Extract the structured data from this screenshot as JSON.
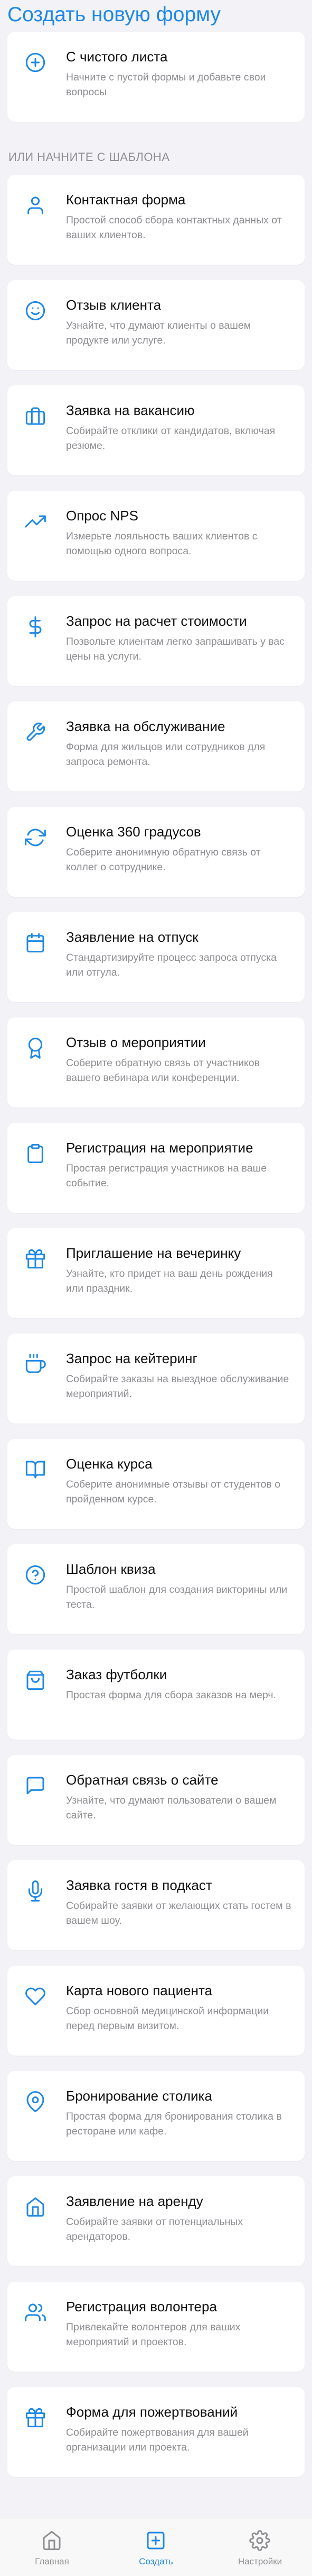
{
  "page": {
    "title": "Создать новую форму",
    "accent_color": "#1e88e5"
  },
  "blank": {
    "title": "С чистого листа",
    "description": "Начните с пустой формы и добавьте свои вопросы",
    "icon": "plus-circle-icon"
  },
  "templates_section": {
    "label": "ИЛИ НАЧНИТЕ С ШАБЛОНА",
    "items": [
      {
        "title": "Контактная форма",
        "description": "Простой способ сбора контактных данных от ваших клиентов.",
        "icon": "person-icon"
      },
      {
        "title": "Отзыв клиента",
        "description": "Узнайте, что думают клиенты о вашем продукте или услуге.",
        "icon": "smile-icon"
      },
      {
        "title": "Заявка на вакансию",
        "description": "Собирайте отклики от кандидатов, включая резюме.",
        "icon": "briefcase-icon"
      },
      {
        "title": "Опрос NPS",
        "description": "Измерьте лояльность ваших клиентов с помощью одного вопроса.",
        "icon": "trending-up-icon"
      },
      {
        "title": "Запрос на расчет стоимости",
        "description": "Позвольте клиентам легко запрашивать у вас цены на услуги.",
        "icon": "dollar-icon"
      },
      {
        "title": "Заявка на обслуживание",
        "description": "Форма для жильцов или сотрудников для запроса ремонта.",
        "icon": "wrench-icon"
      },
      {
        "title": "Оценка 360 градусов",
        "description": "Соберите анонимную обратную связь от коллег о сотруднике.",
        "icon": "refresh-icon"
      },
      {
        "title": "Заявление на отпуск",
        "description": "Стандартизируйте процесс запроса отпуска или отгула.",
        "icon": "calendar-icon"
      },
      {
        "title": "Отзыв о мероприятии",
        "description": "Соберите обратную связь от участников вашего вебинара или конференции.",
        "icon": "award-icon"
      },
      {
        "title": "Регистрация на мероприятие",
        "description": "Простая регистрация участников на ваше событие.",
        "icon": "clipboard-icon"
      },
      {
        "title": "Приглашение на вечеринку",
        "description": "Узнайте, кто придет на ваш день рождения или праздник.",
        "icon": "gift-icon"
      },
      {
        "title": "Запрос на кейтеринг",
        "description": "Собирайте заказы на выездное обслуживание мероприятий.",
        "icon": "coffee-icon"
      },
      {
        "title": "Оценка курса",
        "description": "Соберите анонимные отзывы от студентов о пройденном курсе.",
        "icon": "book-icon"
      },
      {
        "title": "Шаблон квиза",
        "description": "Простой шаблон для создания викторины или теста.",
        "icon": "help-circle-icon"
      },
      {
        "title": "Заказ футболки",
        "description": "Простая форма для сбора заказов на мерч.",
        "icon": "shopping-bag-icon"
      },
      {
        "title": "Обратная связь о сайте",
        "description": "Узнайте, что думают пользователи о вашем сайте.",
        "icon": "message-square-icon"
      },
      {
        "title": "Заявка гостя в подкаст",
        "description": "Собирайте заявки от желающих стать гостем в вашем шоу.",
        "icon": "mic-icon"
      },
      {
        "title": "Карта нового пациента",
        "description": "Сбор основной медицинской информации перед первым визитом.",
        "icon": "heart-icon"
      },
      {
        "title": "Бронирование столика",
        "description": "Простая форма для бронирования столика в ресторане или кафе.",
        "icon": "map-pin-icon"
      },
      {
        "title": "Заявление на аренду",
        "description": "Собирайте заявки от потенциальных арендаторов.",
        "icon": "home-icon"
      },
      {
        "title": "Регистрация волонтера",
        "description": "Привлекайте волонтеров для ваших мероприятий и проектов.",
        "icon": "users-icon"
      },
      {
        "title": "Форма для пожертвований",
        "description": "Собирайте пожертвования для вашей организации или проекта.",
        "icon": "gift-icon"
      }
    ]
  },
  "tabbar": {
    "tabs": [
      {
        "label": "Главная",
        "icon": "home-icon",
        "active": false
      },
      {
        "label": "Создать",
        "icon": "plus-square-icon",
        "active": true
      },
      {
        "label": "Настройки",
        "icon": "settings-icon",
        "active": false
      }
    ]
  }
}
